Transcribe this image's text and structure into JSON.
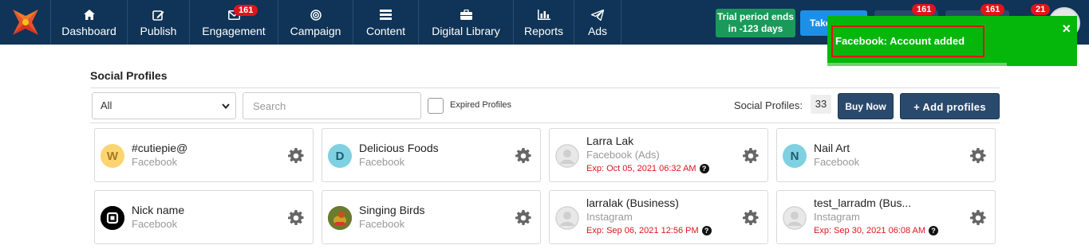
{
  "nav": {
    "items": [
      {
        "label": "Dashboard",
        "icon": "home-icon"
      },
      {
        "label": "Publish",
        "icon": "edit-icon"
      },
      {
        "label": "Engagement",
        "icon": "envelope-icon",
        "badge": "161"
      },
      {
        "label": "Campaign",
        "icon": "target-icon"
      },
      {
        "label": "Content",
        "icon": "list-icon"
      },
      {
        "label": "Digital Library",
        "icon": "briefcase-icon"
      },
      {
        "label": "Reports",
        "icon": "bar-chart-icon"
      },
      {
        "label": "Ads",
        "icon": "paper-plane-icon"
      }
    ]
  },
  "trial": {
    "line1": "Trial period ends",
    "line2": "in -123 days"
  },
  "take_button": "Take",
  "badges": {
    "b1": "161",
    "b2": "161",
    "b3": "21"
  },
  "toast": {
    "message": "Facebook: Account added",
    "close": "×"
  },
  "page": {
    "title": "Social Profiles",
    "filter_value": "All",
    "search_placeholder": "Search",
    "expired_label": "Expired Profiles",
    "profiles_label": "Social Profiles:",
    "profiles_count": "33",
    "buy_now": "Buy Now",
    "add_profiles": "+ Add profiles"
  },
  "profiles": [
    {
      "name": "#cutiepie@",
      "platform": "Facebook",
      "avatar": "W",
      "avatar_bg": "#fcd572",
      "avatar_fg": "#a57c1b"
    },
    {
      "name": "Delicious Foods",
      "platform": "Facebook",
      "avatar": "D",
      "avatar_bg": "#7fd0e0",
      "avatar_fg": "#1f5d70"
    },
    {
      "name": "Larra Lak",
      "platform": "Facebook (Ads)",
      "expiry": "Exp: Oct 05, 2021 06:32 AM"
    },
    {
      "name": "Nail Art",
      "platform": "Facebook",
      "avatar": "N",
      "avatar_bg": "#7fd0e0",
      "avatar_fg": "#1f5d70"
    },
    {
      "name": "Nick name",
      "platform": "Facebook"
    },
    {
      "name": "Singing Birds",
      "platform": "Facebook"
    },
    {
      "name": "larralak (Business)",
      "platform": "Instagram",
      "expiry": "Exp: Sep 06, 2021 12:56 PM"
    },
    {
      "name": "test_larradm (Bus...",
      "platform": "Instagram",
      "expiry": "Exp: Sep 30, 2021 06:08 AM"
    }
  ],
  "colors": {
    "navbar": "#0f3457",
    "toast": "#05b70b",
    "expiry": "#e0141c",
    "primary_button": "#2a4a6d",
    "trial": "#1a9a5a"
  }
}
